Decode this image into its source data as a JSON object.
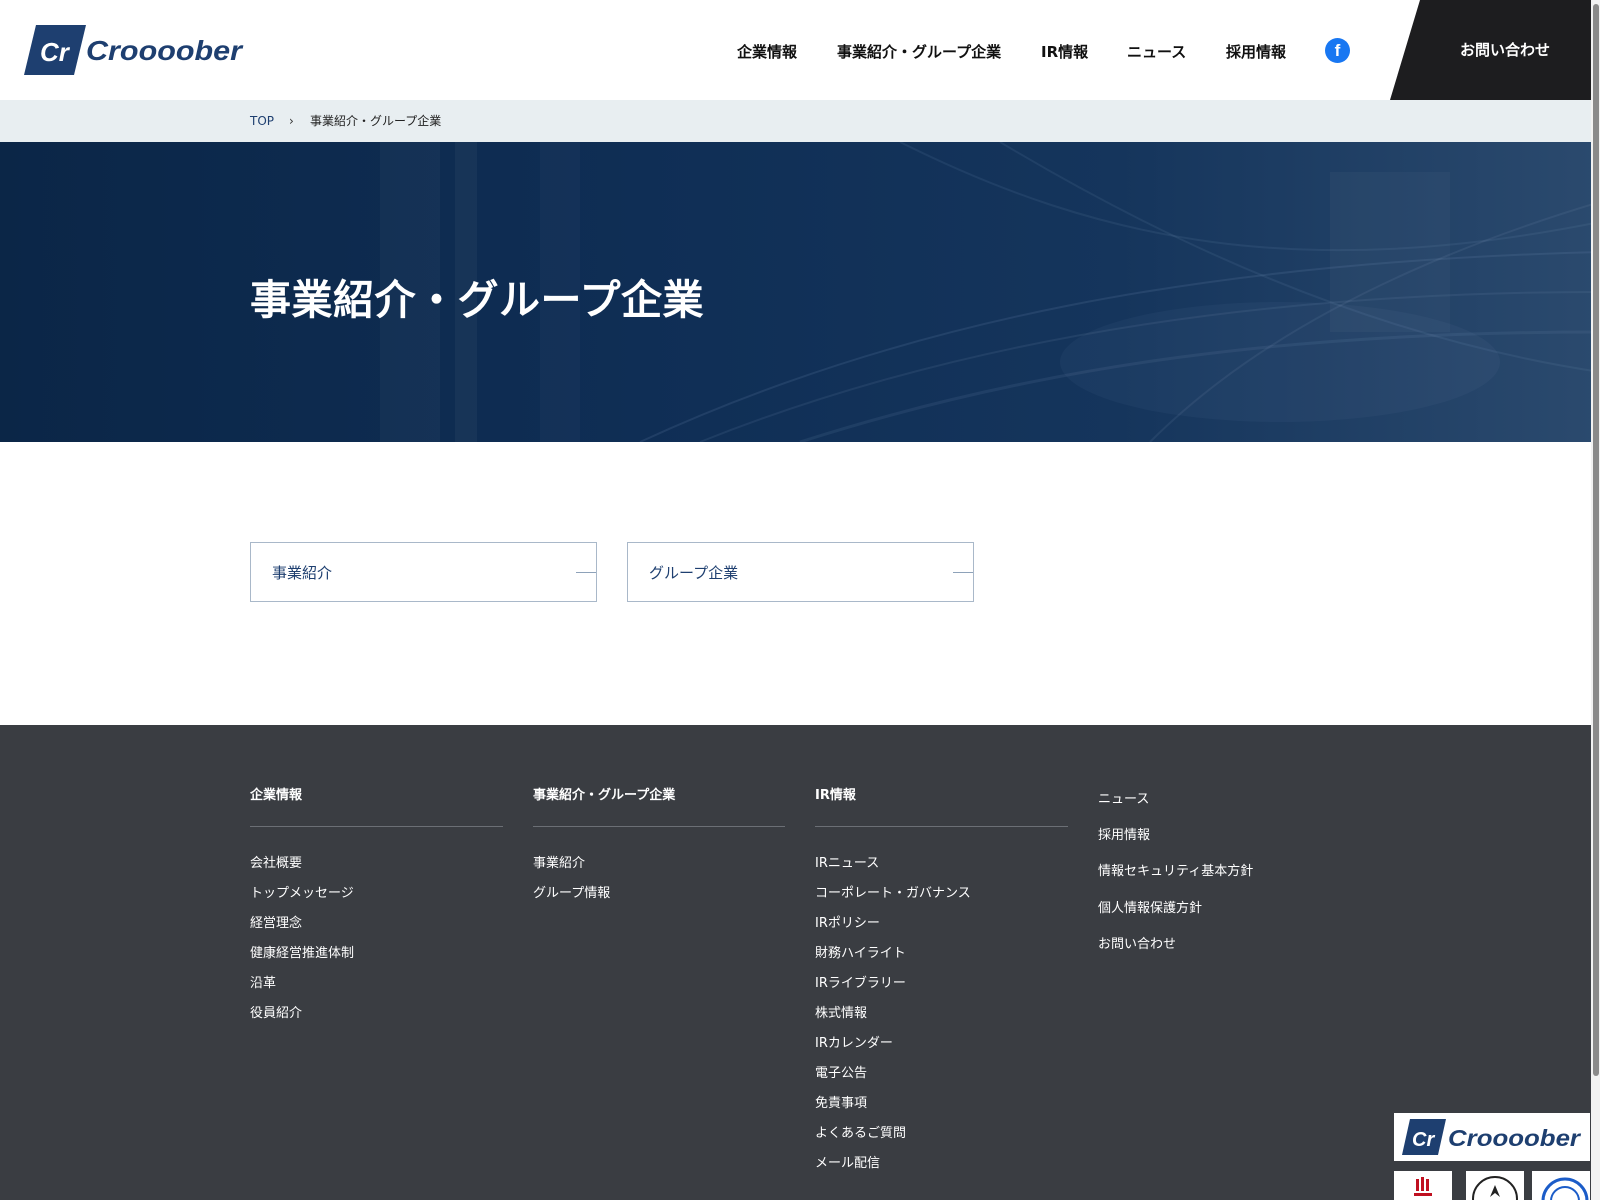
{
  "brand": {
    "name": "Croooober",
    "mark": "Cr",
    "color": "#1e3f70"
  },
  "header": {
    "nav": [
      {
        "label": "企業情報",
        "key": "company"
      },
      {
        "label": "事業紹介・グループ企業",
        "key": "business"
      },
      {
        "label": "IR情報",
        "key": "ir"
      },
      {
        "label": "ニュース",
        "key": "news"
      },
      {
        "label": "採用情報",
        "key": "recruit"
      }
    ],
    "social_icon": "facebook-icon",
    "social_glyph": "f",
    "contact_label": "お問い合わせ"
  },
  "breadcrumb": {
    "top": "TOP",
    "separator": "›",
    "current": "事業紹介・グループ企業"
  },
  "hero": {
    "title": "事業紹介・グループ企業"
  },
  "cards": [
    {
      "label": "事業紹介"
    },
    {
      "label": "グループ企業"
    }
  ],
  "footer": {
    "columns": [
      {
        "heading": "企業情報",
        "links": [
          "会社概要",
          "トップメッセージ",
          "経営理念",
          "健康経営推進体制",
          "沿革",
          "役員紹介"
        ]
      },
      {
        "heading": "事業紹介・グループ企業",
        "links": [
          "事業紹介",
          "グループ情報"
        ]
      },
      {
        "heading": "IR情報",
        "links": [
          "IRニュース",
          "コーポレート・ガバナンス",
          "IRポリシー",
          "財務ハイライト",
          "IRライブラリー",
          "株式情報",
          "IRカレンダー",
          "電子公告",
          "免責事項",
          "よくあるご質問",
          "メール配信"
        ]
      }
    ],
    "side_links": [
      "ニュース",
      "採用情報",
      "情報セキュリティ基本方針",
      "個人情報保護方針",
      "お問い合わせ"
    ],
    "badges": [
      "croooober-logo",
      "certification-badge-1",
      "certification-badge-2",
      "certification-badge-3"
    ]
  }
}
